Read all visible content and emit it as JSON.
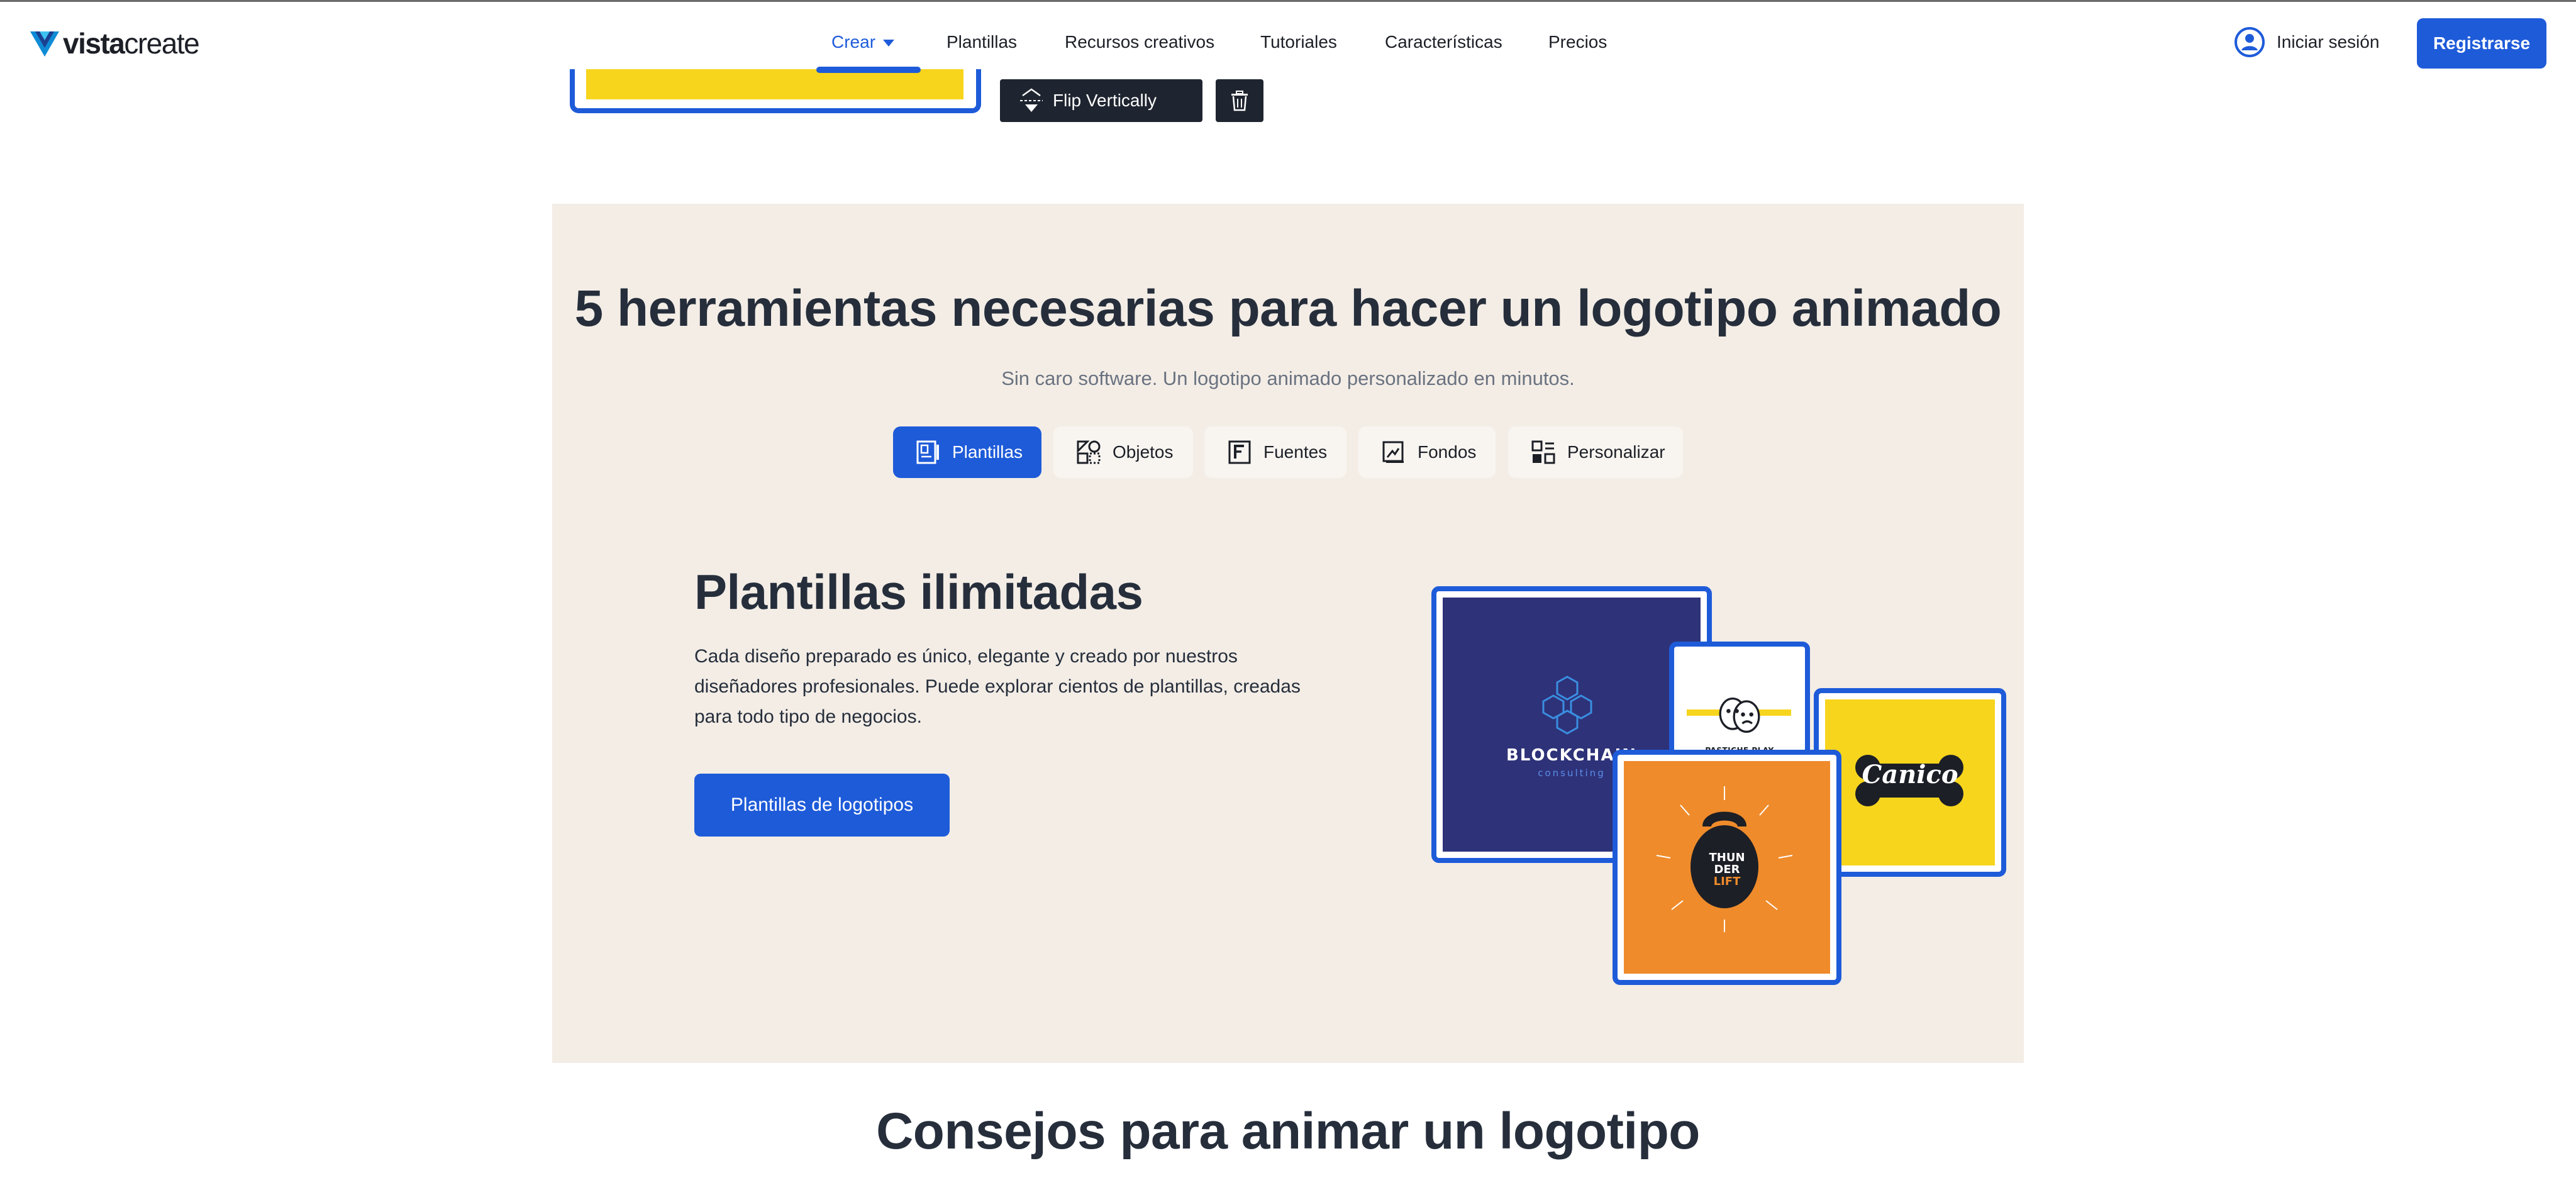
{
  "header": {
    "logo_bold": "vista",
    "logo_light": "create",
    "menu": [
      {
        "label": "Crear",
        "active": true
      },
      {
        "label": "Plantillas"
      },
      {
        "label": "Recursos creativos"
      },
      {
        "label": "Tutoriales"
      },
      {
        "label": "Características"
      },
      {
        "label": "Precios"
      }
    ],
    "login_label": "Iniciar sesión",
    "register_label": "Registrarse"
  },
  "editor_preview": {
    "flip_label": "Flip Vertically",
    "flip_icon": "flip-vertical-icon",
    "delete_icon": "trash-icon"
  },
  "tools_section": {
    "title": "5 herramientas necesarias para hacer un logotipo animado",
    "subtitle": "Sin caro software. Un logotipo animado personalizado en minutos.",
    "tabs": [
      {
        "label": "Plantillas",
        "icon": "templates-icon",
        "active": true
      },
      {
        "label": "Objetos",
        "icon": "objects-icon"
      },
      {
        "label": "Fuentes",
        "icon": "fonts-icon"
      },
      {
        "label": "Fondos",
        "icon": "backgrounds-icon"
      },
      {
        "label": "Personalizar",
        "icon": "customize-icon"
      }
    ],
    "feature": {
      "title": "Plantillas ilimitadas",
      "description": "Cada diseño preparado es único, elegante y creado por nuestros diseñadores profesionales. Puede explorar cientos de plantillas, creadas para todo tipo de negocios.",
      "button_label": "Plantillas de logotipos"
    },
    "collage": {
      "blockchain_name": "BLOCKCHAIN",
      "blockchain_sub": "consulting",
      "pastiche_name": "PASTICHE PLAY",
      "canico_name": "Canico",
      "fitness_line1": "THUN",
      "fitness_line2": "DER",
      "fitness_line3": "LIFT"
    }
  },
  "tips_section": {
    "title": "Consejos para animar un logotipo"
  },
  "colors": {
    "accent": "#1e5bd9",
    "section_bg": "#f3ede6",
    "text_dark": "#262e3b"
  }
}
